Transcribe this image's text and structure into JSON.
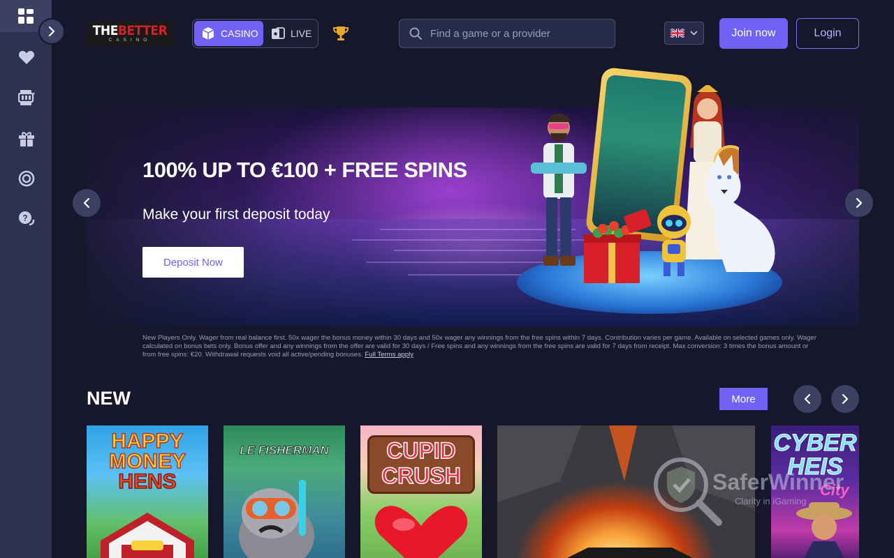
{
  "header": {
    "logo": {
      "part1": "THE",
      "part2": "BETTER",
      "sub": "CASINO"
    },
    "mode_switch": {
      "casino_label": "CASINO",
      "live_label": "LIVE",
      "active": "CASINO"
    },
    "search": {
      "placeholder": "Find a game or a provider",
      "value": ""
    },
    "language": {
      "flag": "uk-flag-icon"
    },
    "join_label": "Join now",
    "login_label": "Login"
  },
  "sidebar": {
    "items": [
      {
        "icon": "dashboard-icon"
      },
      {
        "icon": "heart-icon"
      },
      {
        "icon": "slot-machine-icon"
      },
      {
        "icon": "gift-icon"
      },
      {
        "icon": "chip-icon"
      },
      {
        "icon": "help-chat-icon"
      }
    ]
  },
  "hero": {
    "title": "100% UP TO €100 + FREE SPINS",
    "subtitle": "Make your first deposit today",
    "cta_label": "Deposit Now"
  },
  "terms": {
    "text": "New Players Only. Wager from real balance first. 50x wager the bonus money within 30 days and 50x wager any winnings from the free spins within 7 days. Contribution varies per game. Available on selected games only. Wager calculated on bonus bets only. Bonus offer and any winnings from the offer are valid for 30 days / Free spins and any winnings from the free spins are valid for 7 days from receipt. Max conversion: 3 times the bonus amount or from free spins: €20. Withdrawal requests void all active/pending bonuses.",
    "link_label": "Full Terms apply"
  },
  "new_section": {
    "title": "NEW",
    "more_label": "More",
    "games": [
      {
        "title_line1": "HAPPY",
        "title_line2": "MONEY",
        "title_line3": "HENS"
      },
      {
        "title": "LE FISHERMAN"
      },
      {
        "title_line1": "CUPID",
        "title_line2": "CRUSH"
      },
      {
        "title": ""
      },
      {
        "title_line1": "CYBER",
        "title_line2": "HEIS",
        "title_line3": "City"
      }
    ]
  },
  "watermark": {
    "name": "SaferWinner",
    "tagline": "Clarity in iGaming"
  },
  "colors": {
    "accent": "#6f62f5",
    "background": "#16172a",
    "sidebar": "#2e3250",
    "control": "#3c4062"
  }
}
